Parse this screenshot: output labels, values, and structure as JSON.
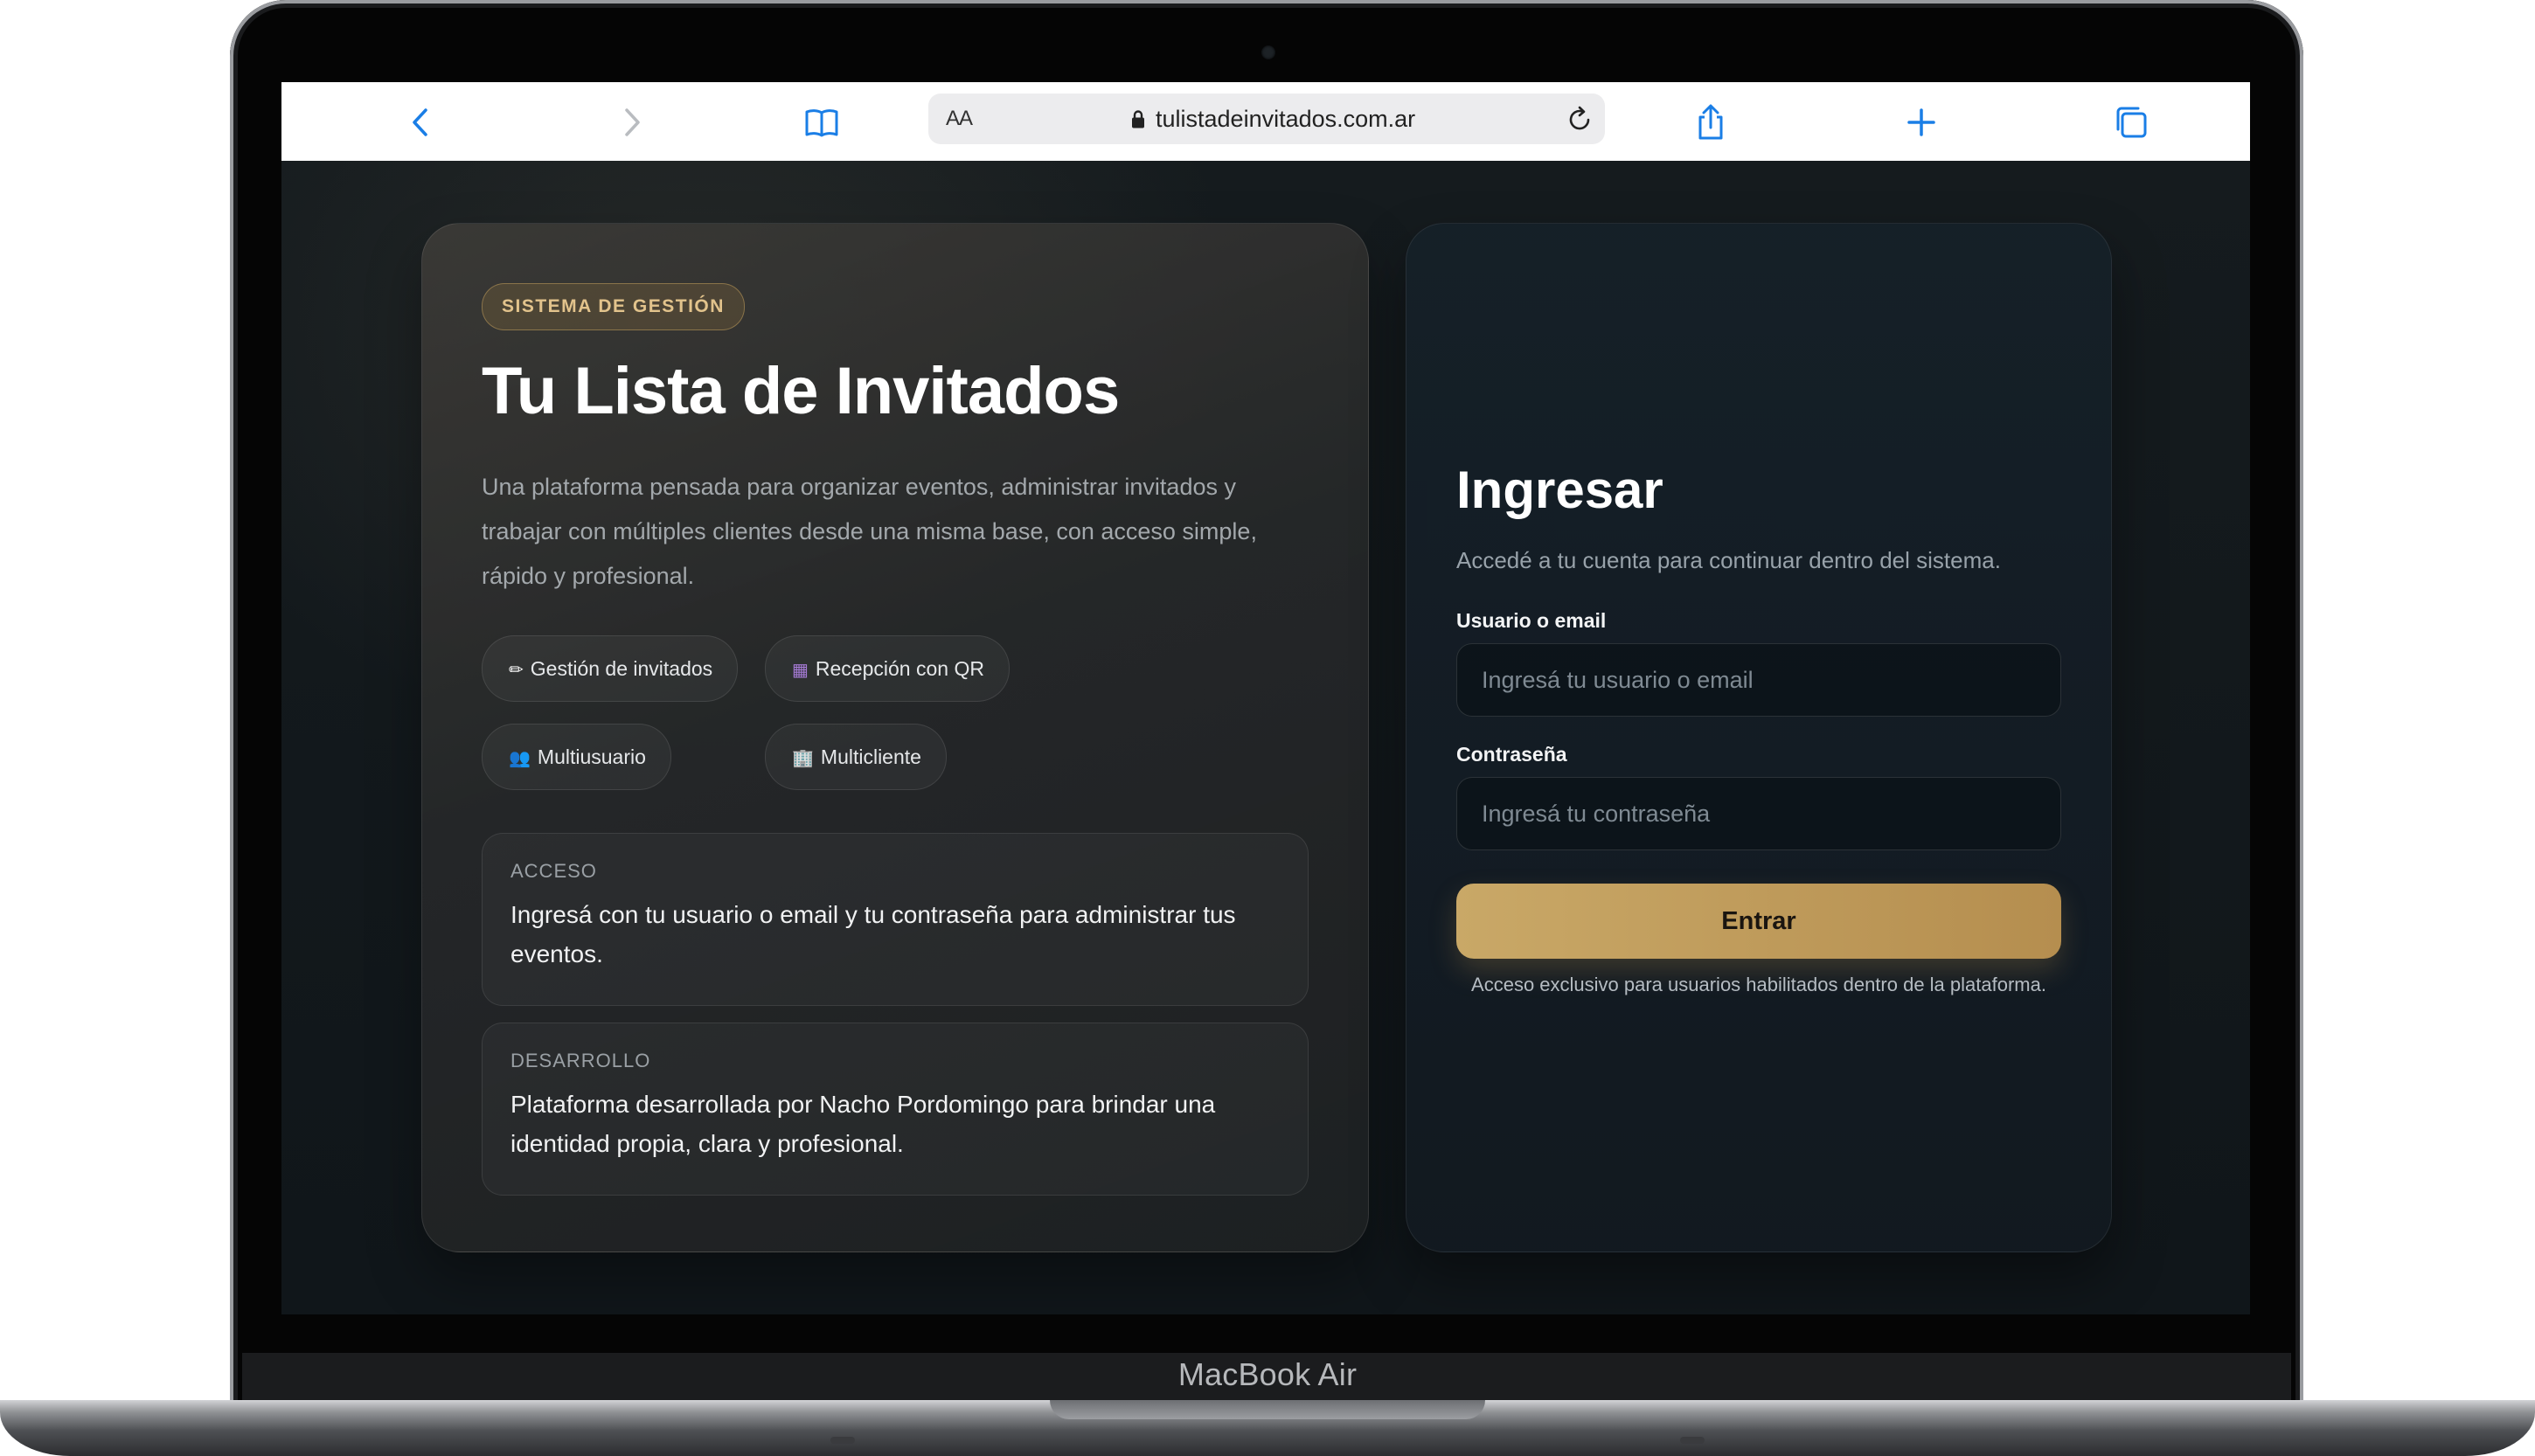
{
  "device": {
    "brand": "MacBook Air"
  },
  "browser": {
    "text_size_label": "AA",
    "url": "tulistadeinvitados.com.ar",
    "icons": [
      "back-icon",
      "forward-icon",
      "bookmarks-icon",
      "lock-icon",
      "reload-icon",
      "share-icon",
      "new-tab-icon",
      "tabs-icon"
    ],
    "accent_color": "#1a7ee6"
  },
  "hero": {
    "badge": "SISTEMA DE GESTIÓN",
    "title": "Tu Lista de Invitados",
    "description": "Una plataforma pensada para organizar eventos, administrar invitados y trabajar con múltiples clientes desde una misma base, con acceso simple, rápido y profesional.",
    "features": [
      {
        "icon": "✏",
        "label": "Gestión de invitados"
      },
      {
        "icon": "▦",
        "label": "Recepción con QR"
      },
      {
        "icon": "👥",
        "label": "Multiusuario"
      },
      {
        "icon": "🏢",
        "label": "Multicliente"
      }
    ],
    "cards": [
      {
        "heading": "ACCESO",
        "text": "Ingresá con tu usuario o email y tu contraseña para administrar tus eventos."
      },
      {
        "heading": "DESARROLLO",
        "text": "Plataforma desarrollada por Nacho Pordomingo para brindar una identidad propia, clara y profesional."
      }
    ]
  },
  "login": {
    "title": "Ingresar",
    "subtitle": "Accedé a tu cuenta para continuar dentro del sistema.",
    "user_label": "Usuario o email",
    "user_placeholder": "Ingresá tu usuario o email",
    "user_value": "",
    "password_label": "Contraseña",
    "password_placeholder": "Ingresá tu contraseña",
    "password_value": "",
    "submit_label": "Entrar",
    "note": "Acceso exclusivo para usuarios habilitados dentro de la plataforma."
  },
  "colors": {
    "gold_accent": "#c9a867",
    "background": "#141a1d",
    "card_dark": "#16202a"
  }
}
